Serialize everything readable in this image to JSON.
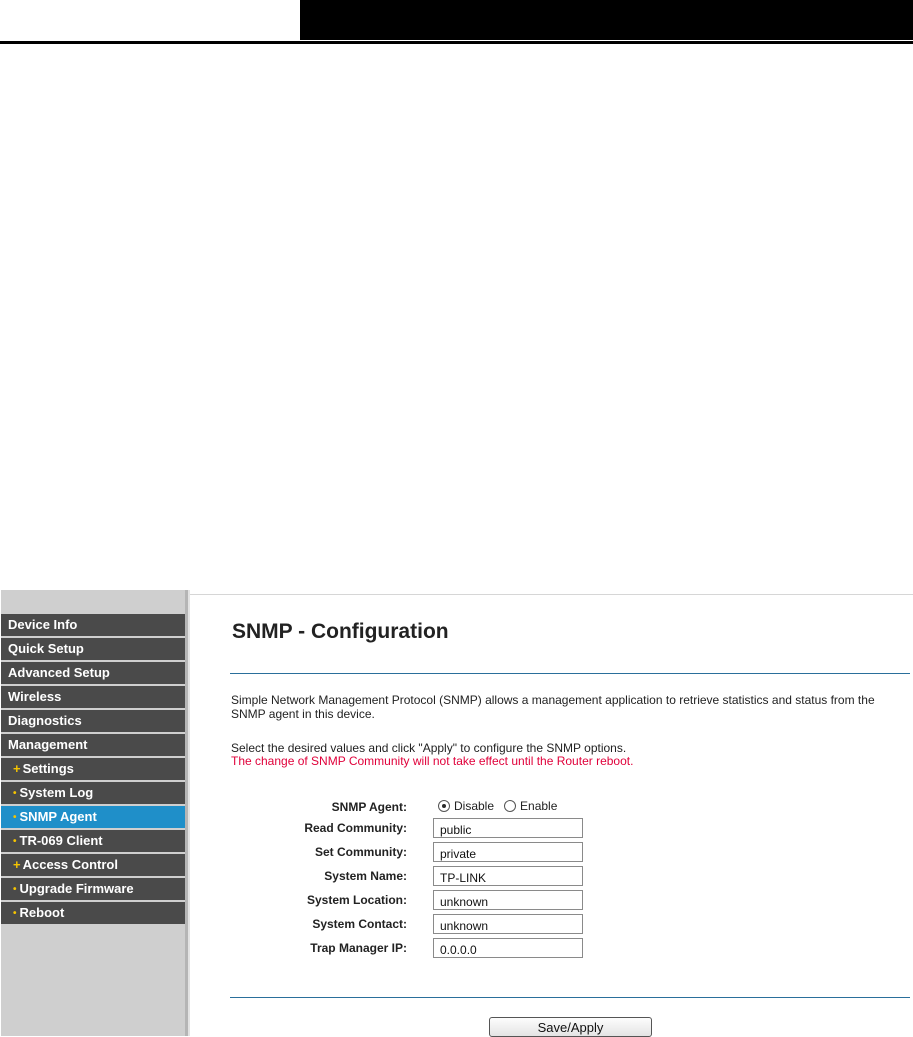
{
  "nav": {
    "items": [
      {
        "label": "Device Info",
        "sub": false,
        "active": false
      },
      {
        "label": "Quick Setup",
        "sub": false,
        "active": false
      },
      {
        "label": "Advanced Setup",
        "sub": false,
        "active": false
      },
      {
        "label": "Wireless",
        "sub": false,
        "active": false
      },
      {
        "label": "Diagnostics",
        "sub": false,
        "active": false
      },
      {
        "label": "Management",
        "sub": false,
        "active": false
      },
      {
        "label": "Settings",
        "sub": true,
        "marker": "+",
        "active": false
      },
      {
        "label": "System Log",
        "sub": true,
        "marker": "•",
        "active": false
      },
      {
        "label": "SNMP Agent",
        "sub": true,
        "marker": "•",
        "active": true
      },
      {
        "label": "TR-069 Client",
        "sub": true,
        "marker": "•",
        "active": false
      },
      {
        "label": "Access Control",
        "sub": true,
        "marker": "+",
        "active": false
      },
      {
        "label": "Upgrade Firmware",
        "sub": true,
        "marker": "•",
        "active": false
      },
      {
        "label": "Reboot",
        "sub": true,
        "marker": "•",
        "active": false
      }
    ]
  },
  "page": {
    "title": "SNMP - Configuration",
    "description": "Simple Network Management Protocol (SNMP) allows a management application to retrieve statistics and status from the SNMP agent in this device.",
    "instruction": "Select the desired values and click \"Apply\" to configure the SNMP options.",
    "warning": "The change of SNMP Community will not take effect until the Router reboot."
  },
  "form": {
    "agent_label": "SNMP Agent:",
    "agent_options": [
      "Disable",
      "Enable"
    ],
    "agent_selected": "Disable",
    "read_community_label": "Read Community:",
    "read_community_value": "public",
    "set_community_label": "Set Community:",
    "set_community_value": "private",
    "system_name_label": "System Name:",
    "system_name_value": "TP-LINK",
    "system_location_label": "System Location:",
    "system_location_value": "unknown",
    "system_contact_label": "System Contact:",
    "system_contact_value": "unknown",
    "trap_ip_label": "Trap Manager IP:",
    "trap_ip_value": "0.0.0.0"
  },
  "actions": {
    "save_label": "Save/Apply"
  },
  "colors": {
    "nav_bg": "#4a4a4a",
    "nav_active": "#1f8fc9",
    "bullet": "#f5c400",
    "rule": "#2a6f9b",
    "warning": "#e0003a"
  }
}
